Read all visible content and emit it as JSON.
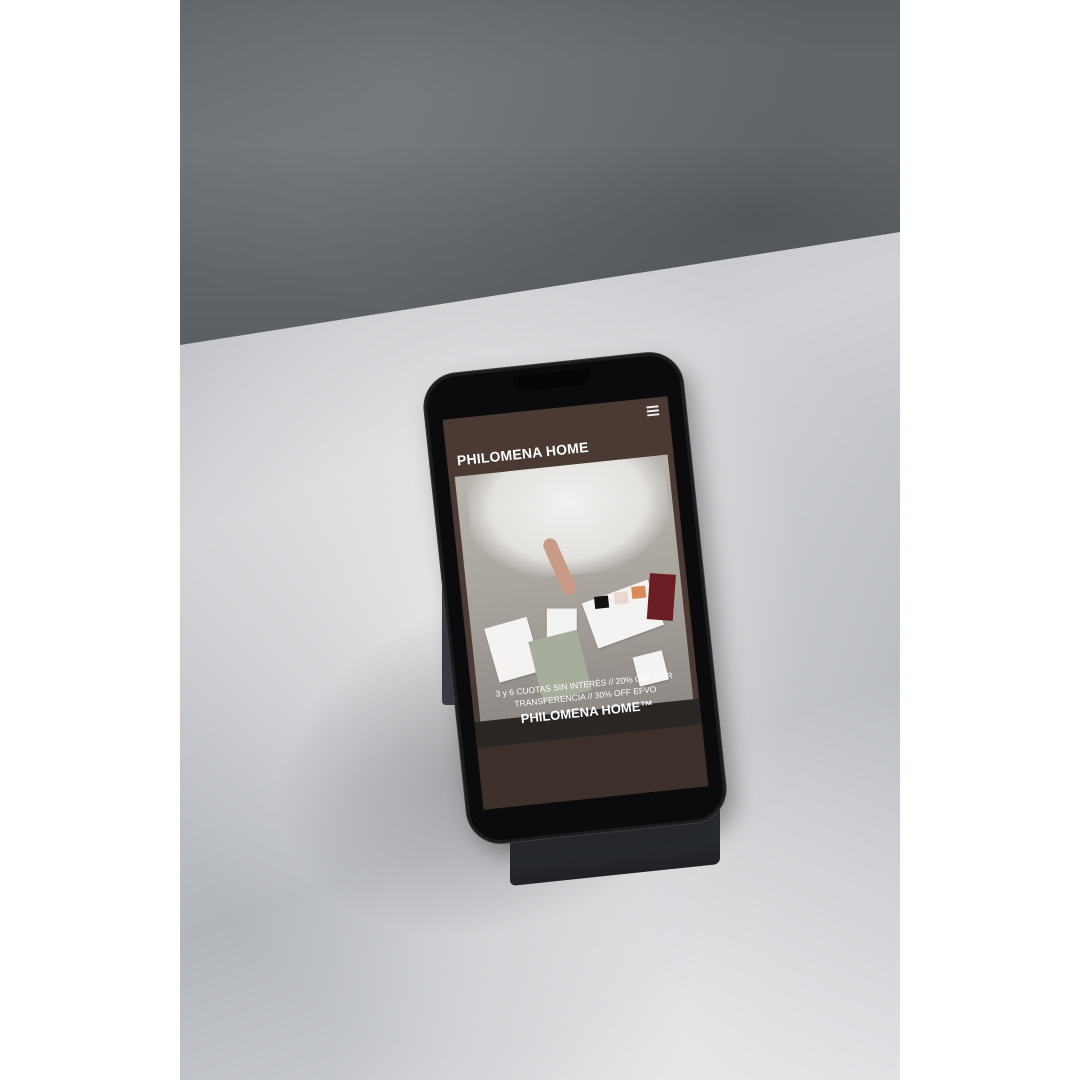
{
  "site": {
    "brand": "PHILOMENA HOME",
    "menu_icon": "hamburger-menu-icon"
  },
  "promo": {
    "line1": "3 y 6 CUOTAS SIN INTERÉS // 20% OFF POR",
    "line2": "TRANSFERENCIA // 30% OFF EFVO",
    "brand": "PHILOMENA HOME™"
  },
  "colors": {
    "header": "#4b3a34",
    "page_background": "#4a3a33",
    "text": "#ffffff"
  }
}
